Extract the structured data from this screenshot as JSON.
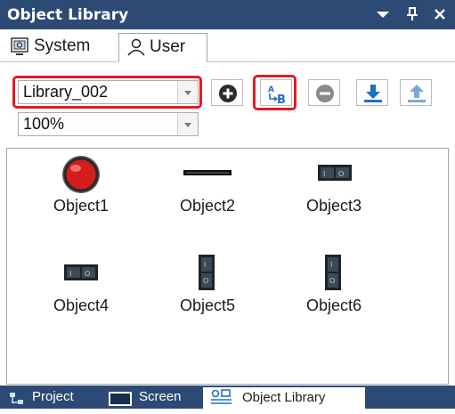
{
  "window": {
    "title": "Object Library",
    "icons": [
      "dropdown-menu-icon",
      "pin-icon",
      "close-icon"
    ]
  },
  "tabs": [
    {
      "label": "System",
      "icon": "system-icon",
      "active": false
    },
    {
      "label": "User",
      "icon": "user-icon",
      "active": true
    }
  ],
  "toolbar": {
    "library_select": {
      "value": "Library_002"
    },
    "zoom_select": {
      "value": "100%"
    },
    "buttons": [
      {
        "name": "add-library",
        "icon": "plus-circle-icon"
      },
      {
        "name": "rename-library",
        "icon": "rename-a-to-b-icon"
      },
      {
        "name": "remove-library",
        "icon": "minus-circle-icon"
      },
      {
        "name": "import-library",
        "icon": "download-icon"
      },
      {
        "name": "export-library",
        "icon": "upload-icon"
      }
    ],
    "highlight_color": "#e31b23"
  },
  "objects": [
    {
      "label": "Object1",
      "icon": "red-lamp-icon"
    },
    {
      "label": "Object2",
      "icon": "black-bar-icon"
    },
    {
      "label": "Object3",
      "icon": "horizontal-switch-icon"
    },
    {
      "label": "Object4",
      "icon": "horizontal-switch-icon"
    },
    {
      "label": "Object5",
      "icon": "vertical-switch-icon"
    },
    {
      "label": "Object6",
      "icon": "vertical-switch-icon"
    }
  ],
  "bottom_tabs": [
    {
      "label": "Project",
      "icon": "project-tree-icon",
      "active": false
    },
    {
      "label": "Screen",
      "icon": "screen-icon",
      "active": false
    },
    {
      "label": "Object Library",
      "icon": "object-library-icon",
      "active": true
    }
  ],
  "colors": {
    "titlebar_bg": "#2d4a75",
    "accent_blue": "#1f6fc6"
  }
}
